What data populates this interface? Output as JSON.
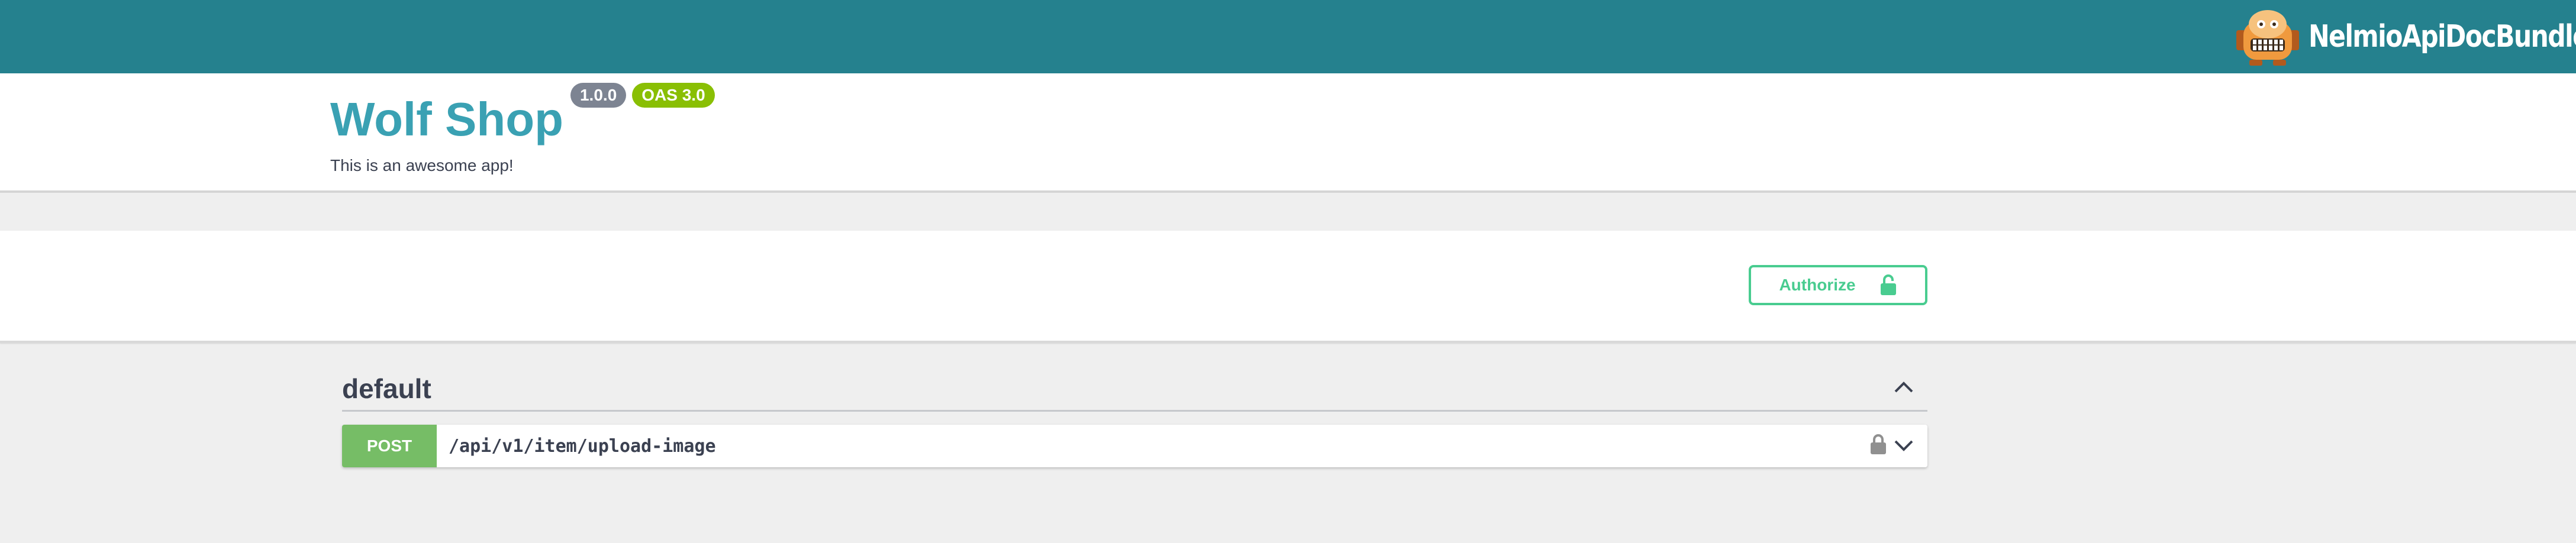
{
  "topbar": {
    "brand_name": "NelmioApiDocBundle",
    "logo_icon": "nelmio-robot-logo",
    "background_color": "#25818e"
  },
  "info": {
    "title": "Wolf Shop",
    "version_badge": "1.0.0",
    "oas_badge": "OAS 3.0",
    "description": "This is an awesome app!"
  },
  "scheme": {
    "authorize_label": "Authorize",
    "authorize_icon": "unlock-icon",
    "accent_color": "#49cc90"
  },
  "operations": {
    "tag": {
      "name": "default",
      "toggle_icon": "chevron-up-icon"
    },
    "items": [
      {
        "method": "POST",
        "path": "/api/v1/item/upload-image",
        "lock_icon": "lock-icon",
        "toggle_icon": "chevron-down-icon",
        "method_color": "#76bd66"
      }
    ]
  }
}
